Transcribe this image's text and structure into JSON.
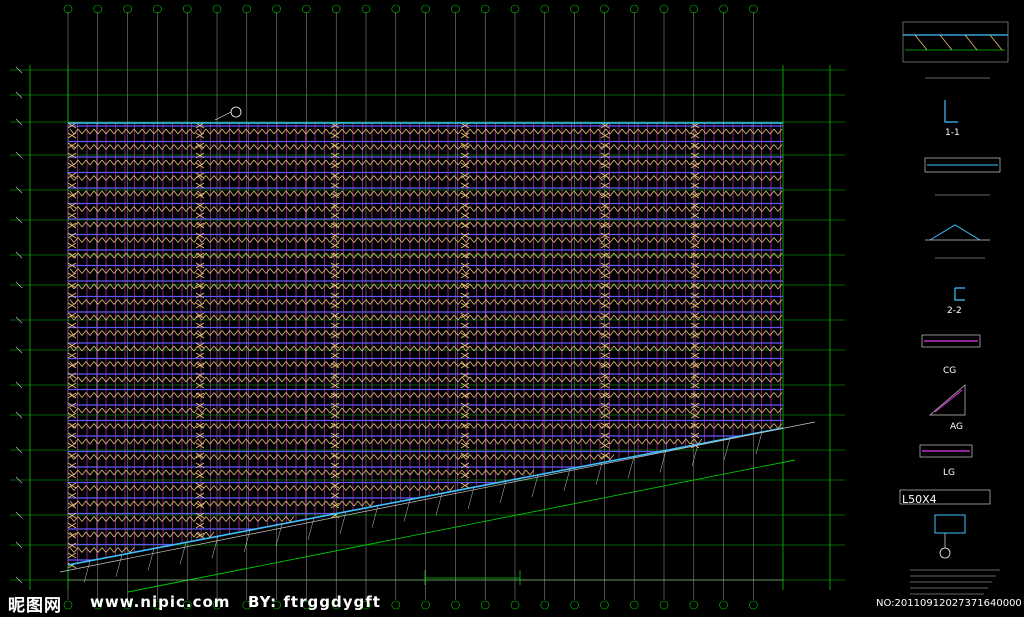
{
  "watermark": {
    "logo": "昵图网",
    "site": "www.nipic.com",
    "author": "BY: ftrggdygft",
    "id": "NO:20110912027371640000"
  },
  "details": {
    "section_1": "1-1",
    "section_2": "2-2",
    "cg": "CG",
    "ag": "AG",
    "lg": "LG",
    "angle_label": "L50X4"
  },
  "colors": {
    "background": "#000000",
    "grid_green": "#00c800",
    "grid_white": "#c8c8c8",
    "purlin_blue": "#5a5aff",
    "rafter_magenta": "#c030c0",
    "brace_yellow": "#e8c070",
    "edge_cyan": "#40c0ff"
  }
}
